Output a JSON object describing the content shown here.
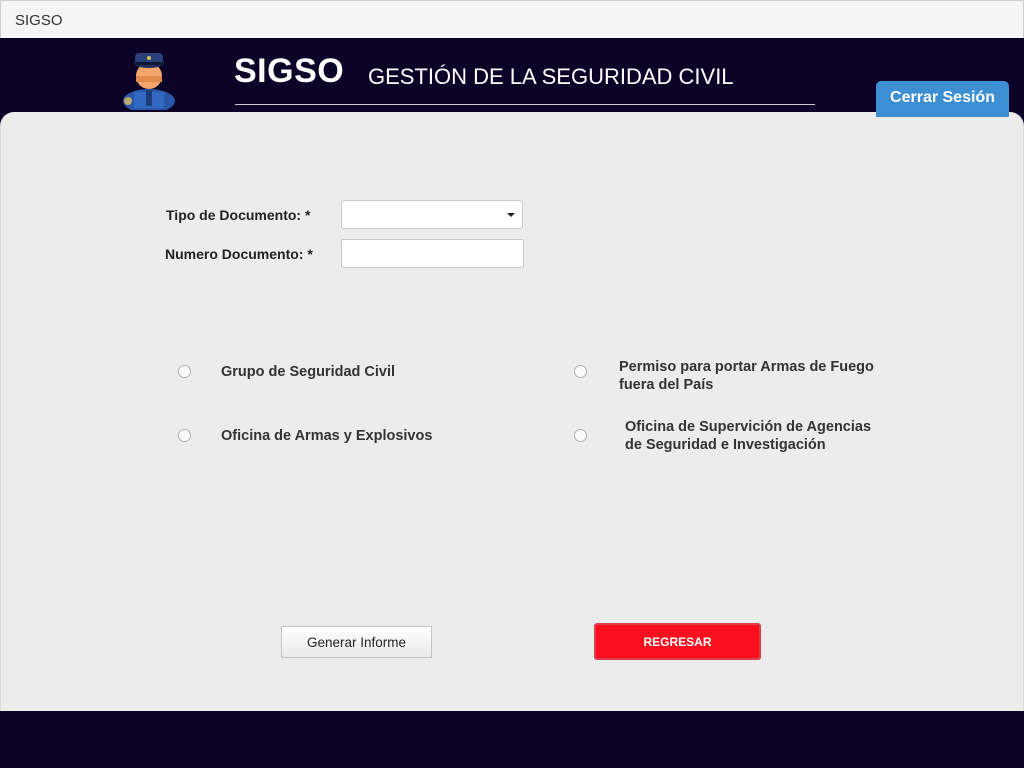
{
  "window": {
    "title": "SIGSO"
  },
  "header": {
    "app_name": "SIGSO",
    "subtitle": "GESTIÓN DE LA SEGURIDAD CIVIL",
    "logout_label": "Cerrar Sesión",
    "avatar_icon": "security-guard-icon"
  },
  "form": {
    "doc_type_label": "Tipo de Documento: *",
    "doc_type_value": "",
    "doc_number_label": "Numero Documento: *",
    "doc_number_value": ""
  },
  "options": {
    "opt1_label": "Grupo de Seguridad Civil",
    "opt2_line1": "Permiso para portar Armas de Fuego",
    "opt2_line2": "fuera del País",
    "opt3_label": "Oficina de Armas y Explosivos",
    "opt4_line1": "Oficina de Supervición de Agencias",
    "opt4_line2": "de Seguridad e Investigación"
  },
  "actions": {
    "report_label": "Generar Informe",
    "back_label": "REGRESAR"
  },
  "colors": {
    "header_bg": "#0c0126",
    "logout_bg": "#3d8fd4",
    "back_bg": "#fb0f1e"
  }
}
